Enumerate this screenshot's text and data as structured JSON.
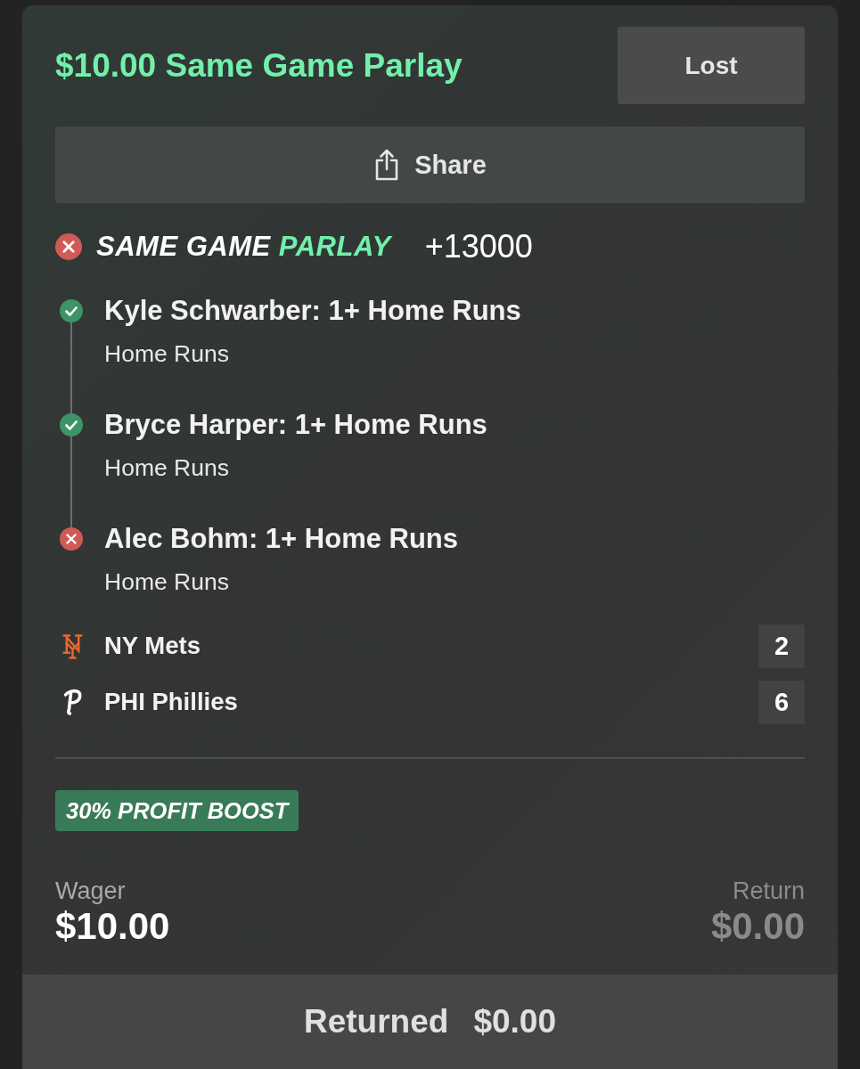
{
  "bet": {
    "title": "$10.00 Same Game Parlay",
    "status": "Lost",
    "share_label": "Share"
  },
  "parlay": {
    "won": false,
    "label": "SAME GAME",
    "label_accent": "PARLAY",
    "odds": "+13000",
    "legs": [
      {
        "selection": "Kyle Schwarber: 1+ Home Runs",
        "market": "Home Runs",
        "won": true
      },
      {
        "selection": "Bryce Harper: 1+ Home Runs",
        "market": "Home Runs",
        "won": true
      },
      {
        "selection": "Alec Bohm: 1+ Home Runs",
        "market": "Home Runs",
        "won": false
      }
    ]
  },
  "teams": [
    {
      "kind": "mets",
      "name": "NY Mets",
      "score": "2"
    },
    {
      "kind": "phillies",
      "name": "PHI Phillies",
      "score": "6"
    }
  ],
  "boost": "30% PROFIT BOOST",
  "wager": {
    "label": "Wager",
    "value": "$10.00"
  },
  "return": {
    "label": "Return",
    "value": "$0.00"
  },
  "returned": {
    "label": "Returned",
    "value": "$0.00"
  }
}
